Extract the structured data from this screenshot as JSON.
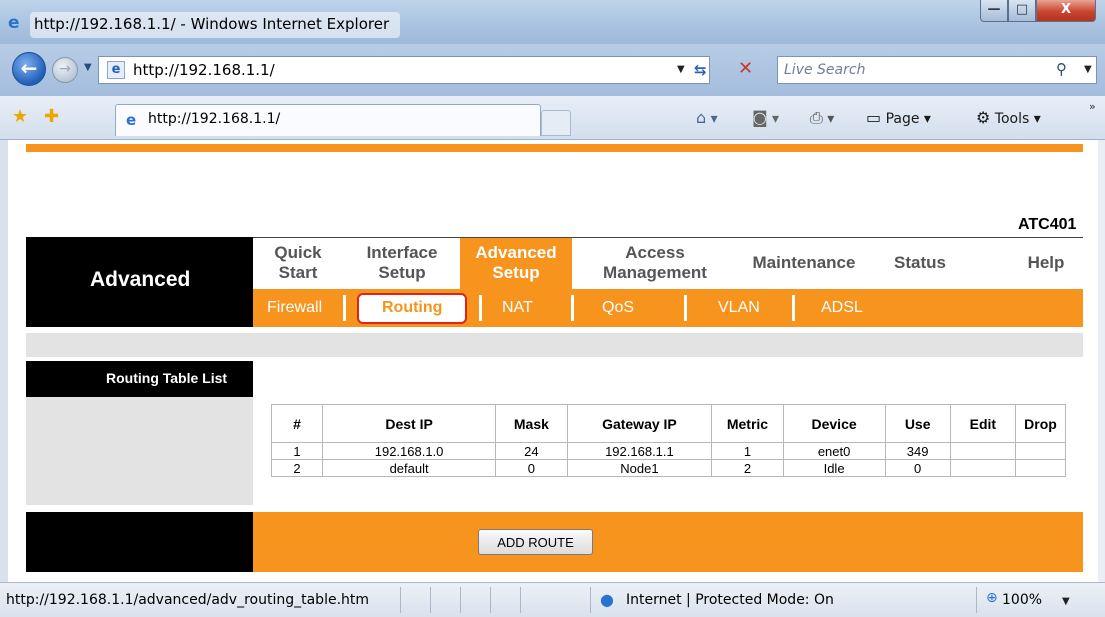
{
  "window": {
    "title": "http://192.168.1.1/ - Windows Internet Explorer",
    "controls": {
      "minimize": "—",
      "maximize": "□",
      "close": "X"
    }
  },
  "navbar": {
    "address": "http://192.168.1.1/",
    "search_placeholder": "Live Search"
  },
  "tabbar": {
    "tab_label": "http://192.168.1.1/",
    "commands": {
      "page": "Page",
      "tools": "Tools"
    }
  },
  "router": {
    "model": "ATC401",
    "section_title": "Advanced",
    "menu": [
      {
        "label": "Quick Start"
      },
      {
        "label": "Interface Setup"
      },
      {
        "label": "Advanced Setup",
        "active": true
      },
      {
        "label": "Access Management"
      },
      {
        "label": "Maintenance"
      },
      {
        "label": "Status"
      },
      {
        "label": "Help"
      }
    ],
    "submenu": [
      {
        "label": "Firewall"
      },
      {
        "label": "Routing",
        "active": true
      },
      {
        "label": "NAT"
      },
      {
        "label": "QoS"
      },
      {
        "label": "VLAN"
      },
      {
        "label": "ADSL"
      }
    ],
    "routing_title": "Routing Table List",
    "table": {
      "headers": [
        "#",
        "Dest IP",
        "Mask",
        "Gateway IP",
        "Metric",
        "Device",
        "Use",
        "Edit",
        "Drop"
      ],
      "rows": [
        [
          "1",
          "192.168.1.0",
          "24",
          "192.168.1.1",
          "1",
          "enet0",
          "349",
          "",
          ""
        ],
        [
          "2",
          "default",
          "0",
          "Node1",
          "2",
          "Idle",
          "0",
          "",
          ""
        ]
      ]
    },
    "add_route_label": "ADD ROUTE"
  },
  "statusbar": {
    "url": "http://192.168.1.1/advanced/adv_routing_table.htm",
    "zone": "Internet | Protected Mode: On",
    "zoom": "100%"
  },
  "colors": {
    "accent": "#f7941e",
    "black": "#000000",
    "highlight": "#e2231a"
  }
}
